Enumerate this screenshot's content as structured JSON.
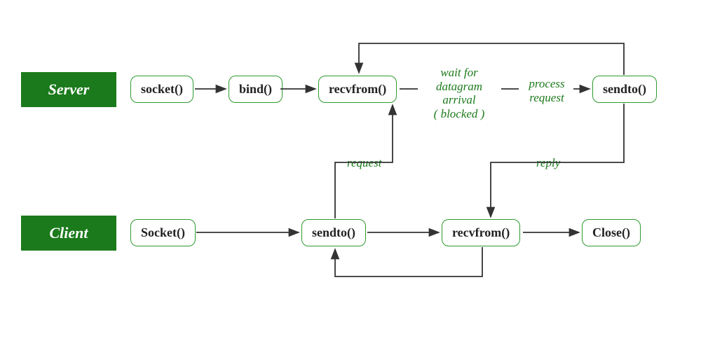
{
  "roles": {
    "server": "Server",
    "client": "Client"
  },
  "server": {
    "socket": "socket()",
    "bind": "bind()",
    "recvfrom": "recvfrom()",
    "sendto": "sendto()"
  },
  "client": {
    "socket": "Socket()",
    "sendto": "sendto()",
    "recvfrom": "recvfrom()",
    "close": "Close()"
  },
  "labels": {
    "wait": "wait for\ndatagram\narrival\n( blocked )",
    "process": "process\nrequest",
    "request": "request",
    "reply": "reply"
  }
}
